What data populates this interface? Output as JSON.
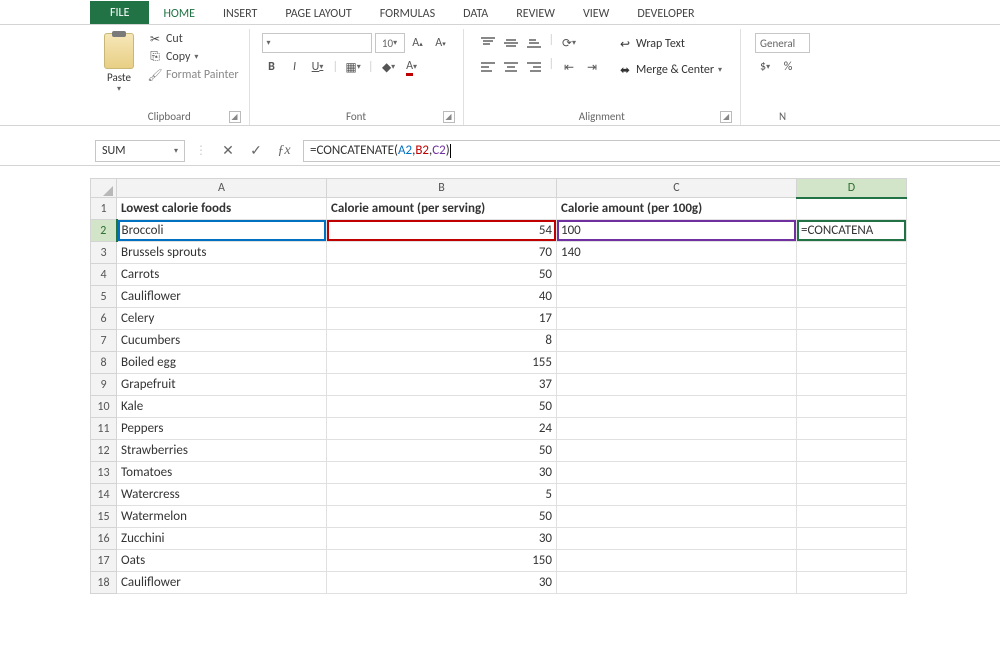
{
  "tabs": {
    "file": "FILE",
    "home": "HOME",
    "insert": "INSERT",
    "pageLayout": "PAGE LAYOUT",
    "formulas": "FORMULAS",
    "data": "DATA",
    "review": "REVIEW",
    "view": "VIEW",
    "developer": "DEVELOPER"
  },
  "ribbon": {
    "clipboard": {
      "label": "Clipboard",
      "paste": "Paste",
      "cut": "Cut",
      "copy": "Copy",
      "formatPainter": "Format Painter"
    },
    "font": {
      "label": "Font",
      "size": "10"
    },
    "alignment": {
      "label": "Alignment",
      "wrapText": "Wrap Text",
      "mergeCenter": "Merge & Center"
    },
    "number": {
      "label": "N",
      "format": "General"
    }
  },
  "formulaBar": {
    "nameBox": "SUM",
    "prefix": "=CONCATENATE(",
    "ref1": "A2",
    "ref2": "B2",
    "ref3": "C2",
    "suffix": ")"
  },
  "columns": [
    "A",
    "B",
    "C",
    "D"
  ],
  "headers": {
    "A": "Lowest calorie foods",
    "B": "Calorie amount (per serving)",
    "C": "Calorie amount (per 100g)"
  },
  "activeCellDisplay": "=CONCATENA",
  "rows": [
    {
      "n": 2,
      "food": "Broccoli",
      "b": "54",
      "c": "100"
    },
    {
      "n": 3,
      "food": "Brussels sprouts",
      "b": "70",
      "c": "140"
    },
    {
      "n": 4,
      "food": "Carrots",
      "b": "50",
      "c": ""
    },
    {
      "n": 5,
      "food": "Cauliflower",
      "b": "40",
      "c": ""
    },
    {
      "n": 6,
      "food": "Celery",
      "b": "17",
      "c": ""
    },
    {
      "n": 7,
      "food": "Cucumbers",
      "b": "8",
      "c": ""
    },
    {
      "n": 8,
      "food": "Boiled egg",
      "b": "155",
      "c": ""
    },
    {
      "n": 9,
      "food": "Grapefruit",
      "b": "37",
      "c": ""
    },
    {
      "n": 10,
      "food": "Kale",
      "b": "50",
      "c": ""
    },
    {
      "n": 11,
      "food": "Peppers",
      "b": "24",
      "c": ""
    },
    {
      "n": 12,
      "food": "Strawberries",
      "b": "50",
      "c": ""
    },
    {
      "n": 13,
      "food": "Tomatoes",
      "b": "30",
      "c": ""
    },
    {
      "n": 14,
      "food": "Watercress",
      "b": "5",
      "c": ""
    },
    {
      "n": 15,
      "food": "Watermelon",
      "b": "50",
      "c": ""
    },
    {
      "n": 16,
      "food": "Zucchini",
      "b": "30",
      "c": ""
    },
    {
      "n": 17,
      "food": "Oats",
      "b": "150",
      "c": ""
    },
    {
      "n": 18,
      "food": "Cauliflower",
      "b": "30",
      "c": ""
    }
  ]
}
